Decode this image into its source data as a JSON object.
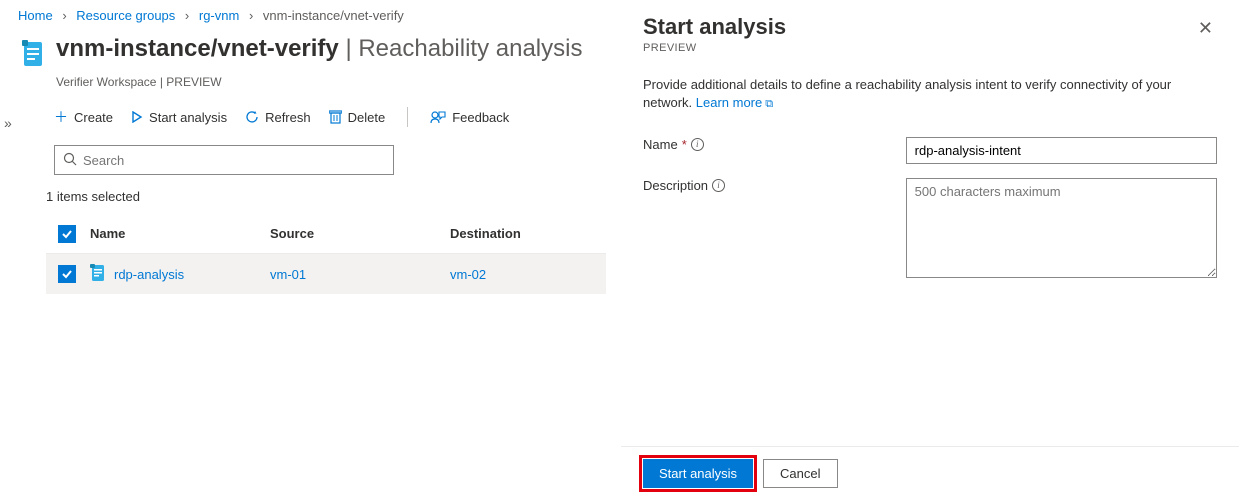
{
  "breadcrumbs": {
    "home": "Home",
    "rg": "Resource groups",
    "rgname": "rg-vnm",
    "current": "vnm-instance/vnet-verify"
  },
  "title": {
    "resource": "vnm-instance/vnet-verify",
    "section": "Reachability analysis",
    "sub": "Verifier Workspace | PREVIEW"
  },
  "toolbar": {
    "create": "Create",
    "start": "Start analysis",
    "refresh": "Refresh",
    "delete": "Delete",
    "feedback": "Feedback"
  },
  "search": {
    "placeholder": "Search"
  },
  "selection": "1 items selected",
  "table": {
    "headers": {
      "name": "Name",
      "source": "Source",
      "dest": "Destination"
    },
    "row": {
      "name": "rdp-analysis",
      "source": "vm-01",
      "dest": "vm-02"
    }
  },
  "panel": {
    "title": "Start analysis",
    "sub": "PREVIEW",
    "desc": "Provide additional details to define a reachability analysis intent to verify connectivity of your network. ",
    "learn": "Learn more",
    "name_label": "Name",
    "name_value": "rdp-analysis-intent",
    "desc_label": "Description",
    "desc_placeholder": "500 characters maximum",
    "start_btn": "Start analysis",
    "cancel_btn": "Cancel"
  }
}
